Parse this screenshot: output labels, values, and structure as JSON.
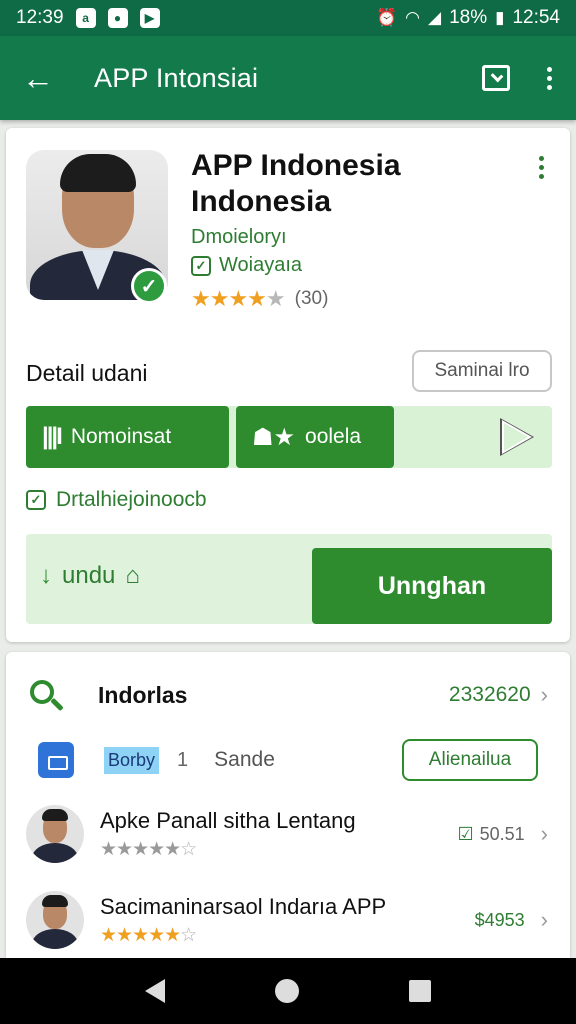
{
  "status_bar": {
    "time": "12:39",
    "battery": "18%",
    "right_time": "12:54",
    "icons": [
      "notification-a-icon",
      "notification-b-icon",
      "notification-c-icon",
      "alarm-icon",
      "wifi-icon",
      "signal-icon",
      "battery-icon"
    ]
  },
  "app_bar": {
    "title": "APP Intonsiai",
    "back_icon": "arrow-left-icon",
    "actions": [
      "bookmark-icon",
      "more-vert-icon"
    ]
  },
  "app_card": {
    "title": "APP Indonesia Indonesia",
    "developer": "Dmoieloryı",
    "installs_label": "Woiayaıa",
    "rating_stars": 4.5,
    "rating_count": "(30)",
    "detail_label": "Detail udani",
    "secondary_button": "Saminai lro",
    "segment_1": "Nomoinsat",
    "segment_2": "oolela",
    "check_text": "Drtalhiejoinoocb",
    "download_left": "undu",
    "download_button": "Unnghan",
    "colors": {
      "primary": "#2e8b2e",
      "light": "#d9f2d6",
      "appbar": "#137a4c"
    }
  },
  "list_card": {
    "search_label": "Indorlas",
    "search_value": "2332620",
    "tag": "Borby",
    "tag_count": "1",
    "sande": "Sande",
    "outline_button": "Alienailua",
    "items": [
      {
        "title": "Apke Panall sitha Lentang",
        "stars": 5,
        "right": "50.51",
        "gold": false
      },
      {
        "title": "Sacimaninarsaol Indarıa APP",
        "stars": 4.5,
        "right": "$4953",
        "gold": true
      }
    ]
  },
  "nav_bar": {
    "icons": [
      "back-nav-icon",
      "home-nav-icon",
      "recents-nav-icon"
    ]
  }
}
